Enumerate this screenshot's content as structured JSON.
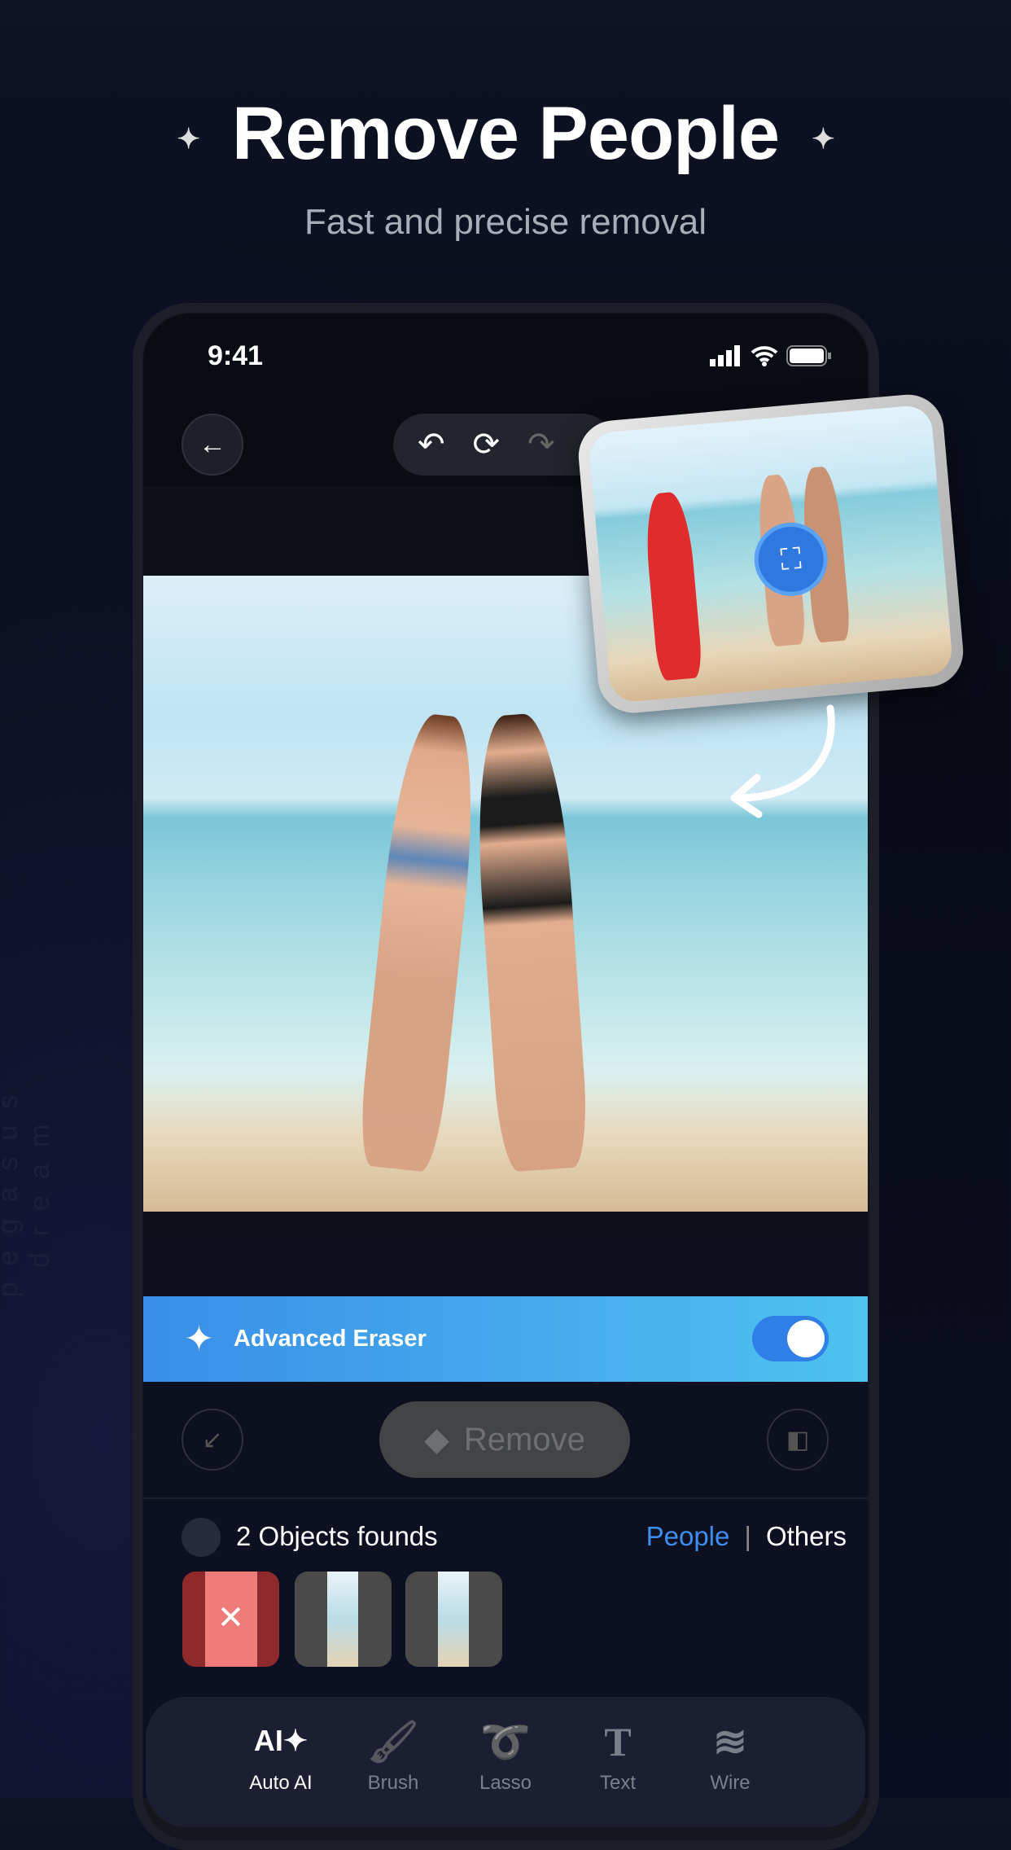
{
  "header": {
    "title": "Remove People",
    "subtitle": "Fast and precise removal",
    "sparkle": "✦"
  },
  "watermark": "pegasus dream",
  "status": {
    "time": "9:41"
  },
  "toolbar": {
    "back_icon": "←",
    "undo_icon": "↶",
    "reset_icon": "⟳",
    "redo_icon": "↷"
  },
  "eraser": {
    "label": "Advanced Eraser",
    "enabled": true,
    "colors": {
      "from": "#3a8ee9",
      "to": "#4ec2ef"
    }
  },
  "actions": {
    "remove_label": "Remove"
  },
  "objects": {
    "count_label": "2 Objects founds",
    "filters": [
      "People",
      "Others"
    ],
    "active_filter": "People",
    "remove_mark": "✕"
  },
  "tabs": [
    {
      "label": "Auto AI",
      "icon": "AI✦"
    },
    {
      "label": "Brush",
      "icon": "🖌"
    },
    {
      "label": "Lasso",
      "icon": "➰"
    },
    {
      "label": "Text",
      "icon": "T"
    },
    {
      "label": "Wire",
      "icon": "≋"
    }
  ],
  "accent": "#3e8df0"
}
